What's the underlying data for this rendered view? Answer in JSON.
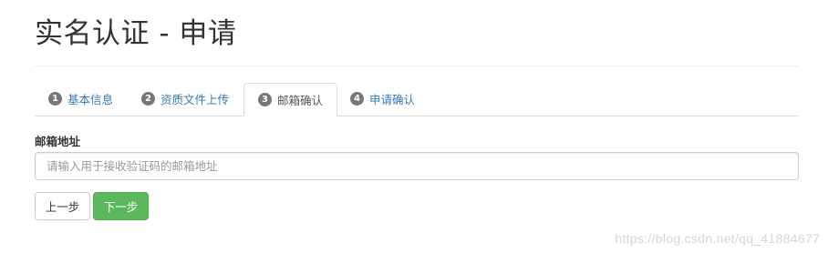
{
  "page": {
    "title": "实名认证 - 申请"
  },
  "tabs": [
    {
      "number": "1",
      "label": "基本信息",
      "active": false
    },
    {
      "number": "2",
      "label": "资质文件上传",
      "active": false
    },
    {
      "number": "3",
      "label": "邮箱确认",
      "active": true
    },
    {
      "number": "4",
      "label": "申请确认",
      "active": false
    }
  ],
  "form": {
    "email_label": "邮箱地址",
    "email_placeholder": "请输入用于接收验证码的邮箱地址",
    "email_value": ""
  },
  "buttons": {
    "prev_label": "上一步",
    "next_label": "下一步"
  },
  "watermark": "https://blog.csdn.net/qq_41884677",
  "colors": {
    "link": "#337ab7",
    "success": "#5cb85c",
    "badge": "#777777"
  }
}
